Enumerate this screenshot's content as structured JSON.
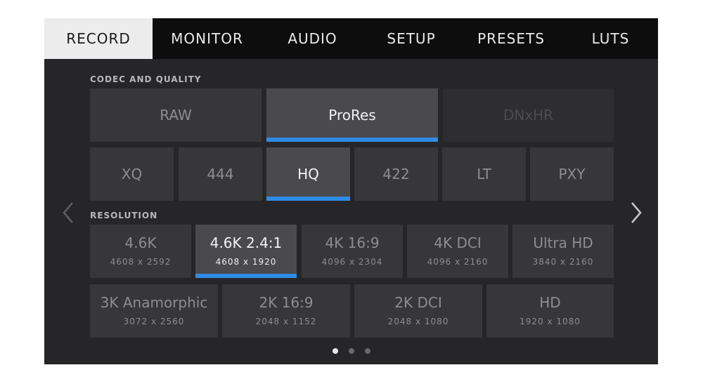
{
  "tabs": [
    {
      "label": "RECORD"
    },
    {
      "label": "MONITOR"
    },
    {
      "label": "AUDIO"
    },
    {
      "label": "SETUP"
    },
    {
      "label": "PRESETS"
    },
    {
      "label": "LUTS"
    }
  ],
  "active_tab": "RECORD",
  "codec_section": {
    "label": "CODEC AND QUALITY",
    "codecs": [
      {
        "label": "RAW",
        "state": "normal"
      },
      {
        "label": "ProRes",
        "state": "selected"
      },
      {
        "label": "DNxHR",
        "state": "disabled"
      }
    ],
    "qualities": [
      {
        "label": "XQ",
        "state": "normal"
      },
      {
        "label": "444",
        "state": "normal"
      },
      {
        "label": "HQ",
        "state": "selected"
      },
      {
        "label": "422",
        "state": "normal"
      },
      {
        "label": "LT",
        "state": "normal"
      },
      {
        "label": "PXY",
        "state": "normal"
      }
    ]
  },
  "resolution_section": {
    "label": "RESOLUTION",
    "row1": [
      {
        "label": "4.6K",
        "dims": "4608 x 2592",
        "state": "normal"
      },
      {
        "label": "4.6K 2.4:1",
        "dims": "4608 x 1920",
        "state": "selected"
      },
      {
        "label": "4K 16:9",
        "dims": "4096 x 2304",
        "state": "normal"
      },
      {
        "label": "4K DCI",
        "dims": "4096 x 2160",
        "state": "normal"
      },
      {
        "label": "Ultra HD",
        "dims": "3840 x 2160",
        "state": "normal"
      }
    ],
    "row2": [
      {
        "label": "3K Anamorphic",
        "dims": "3072 x 2560",
        "state": "normal"
      },
      {
        "label": "2K 16:9",
        "dims": "2048 x 1152",
        "state": "normal"
      },
      {
        "label": "2K DCI",
        "dims": "2048 x 1080",
        "state": "normal"
      },
      {
        "label": "HD",
        "dims": "1920 x 1080",
        "state": "normal"
      }
    ]
  },
  "navigation": {
    "prev_icon": "chevron-left-icon",
    "next_icon": "chevron-right-icon"
  },
  "pagination": {
    "total_pages": 3,
    "current_page": 1
  },
  "colors": {
    "accent": "#2f8ce6",
    "screen_bg": "#262628",
    "button_bg": "#37373a",
    "selected_button_bg": "#4a4a4e",
    "tabbar_bg": "#0d0d0e",
    "active_tab_bg": "#ececec"
  }
}
